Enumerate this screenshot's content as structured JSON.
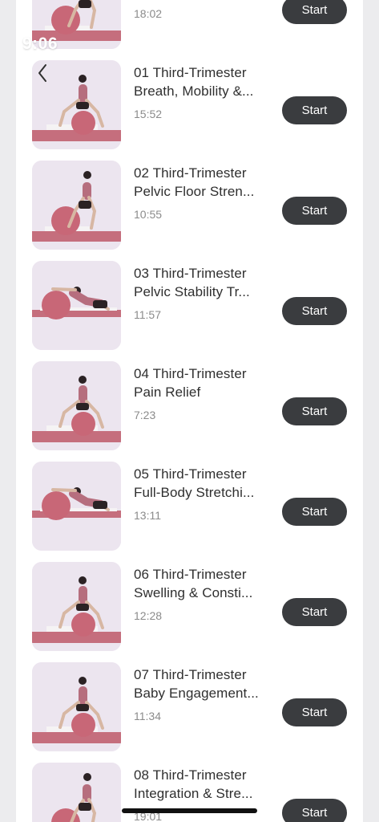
{
  "nav": {
    "back_icon": "chevron-left-icon"
  },
  "workouts": [
    {
      "title": "",
      "duration": "18:02",
      "thumb_time": "9:06",
      "button": "Start",
      "pose": "squat"
    },
    {
      "title": "01 Third-Trimester\nBreath, Mobility &...",
      "duration": "15:52",
      "button": "Start",
      "pose": "sit"
    },
    {
      "title": "02 Third-Trimester\nPelvic Floor Stren...",
      "duration": "10:55",
      "button": "Start",
      "pose": "squat"
    },
    {
      "title": "03 Third-Trimester\nPelvic Stability Tr...",
      "duration": "11:57",
      "button": "Start",
      "pose": "side"
    },
    {
      "title": "04 Third-Trimester\nPain Relief",
      "duration": "7:23",
      "button": "Start",
      "pose": "sit"
    },
    {
      "title": "05 Third-Trimester\nFull-Body Stretchi...",
      "duration": "13:11",
      "button": "Start",
      "pose": "side"
    },
    {
      "title": "06 Third-Trimester\nSwelling & Consti...",
      "duration": "12:28",
      "button": "Start",
      "pose": "sit"
    },
    {
      "title": "07 Third-Trimester\nBaby Engagement...",
      "duration": "11:34",
      "button": "Start",
      "pose": "sit"
    },
    {
      "title": "08 Third-Trimester\nIntegration & Stre...",
      "duration": "19:01",
      "button": "Start",
      "pose": "squat"
    }
  ],
  "colors": {
    "button_bg": "#3a3c3f",
    "button_text": "#ffffff",
    "title_text": "#2f2f2f",
    "duration_text": "#8b8b8b",
    "thumb_bg": "#ece5ef",
    "mat": "#c56e7d",
    "ball": "#c86777"
  }
}
